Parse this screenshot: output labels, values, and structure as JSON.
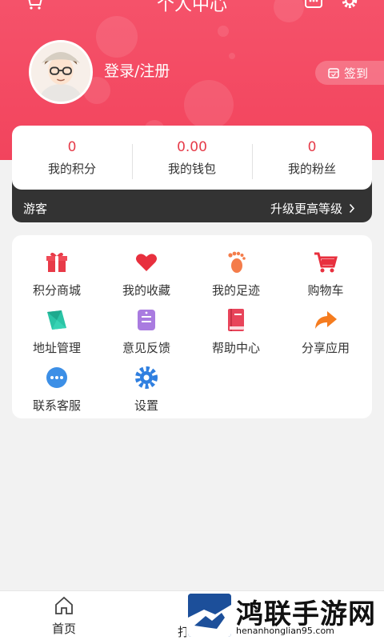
{
  "header": {
    "title": "个人中心",
    "login_text": "登录/注册",
    "checkin_label": "签到"
  },
  "stats": [
    {
      "value": "0",
      "label": "我的积分"
    },
    {
      "value": "0.00",
      "label": "我的钱包"
    },
    {
      "value": "0",
      "label": "我的粉丝"
    }
  ],
  "member": {
    "level": "游客",
    "upgrade": "升级更高等级"
  },
  "menu": [
    {
      "label": "积分商城",
      "icon": "gift-icon"
    },
    {
      "label": "我的收藏",
      "icon": "heart-icon"
    },
    {
      "label": "我的足迹",
      "icon": "footprint-icon"
    },
    {
      "label": "购物车",
      "icon": "cart-icon"
    },
    {
      "label": "地址管理",
      "icon": "map-icon"
    },
    {
      "label": "意见反馈",
      "icon": "feedback-icon"
    },
    {
      "label": "帮助中心",
      "icon": "book-icon"
    },
    {
      "label": "分享应用",
      "icon": "share-icon"
    },
    {
      "label": "联系客服",
      "icon": "chat-icon"
    },
    {
      "label": "设置",
      "icon": "gear-icon"
    }
  ],
  "bottom_nav": {
    "home": "首页",
    "second_partial": "打"
  },
  "watermark": {
    "name": "鸿联手游网",
    "url": "henanhonglian95.com"
  },
  "colors": {
    "header": "#f2445d",
    "accent": "#e63c4a",
    "dark_strip": "#333333"
  }
}
